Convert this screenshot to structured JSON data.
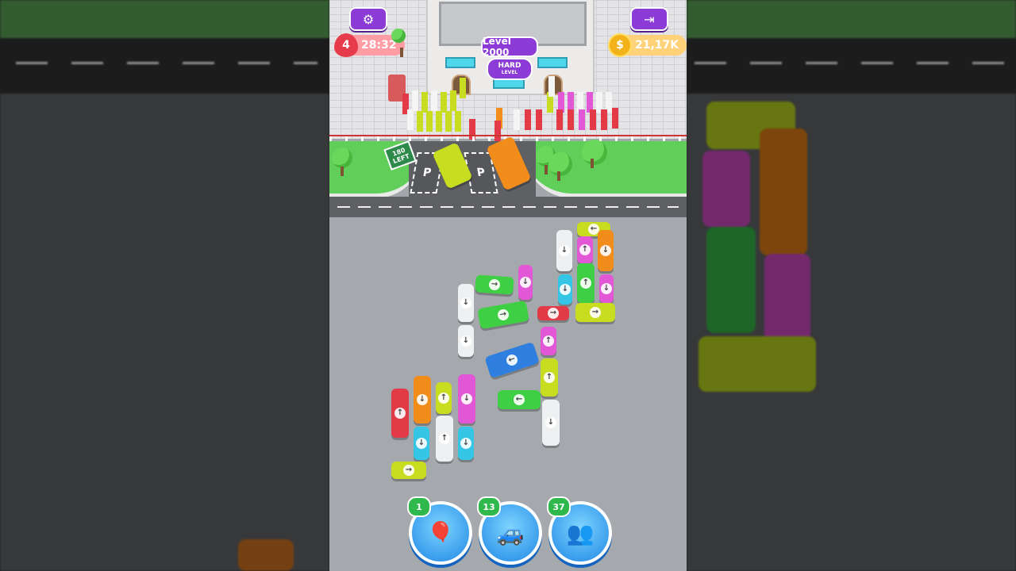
{
  "hud": {
    "settings_icon": "gear-icon",
    "exit_icon": "exit-door-icon",
    "lives": "4",
    "timer": "28:32",
    "coins": "21,17K",
    "coin_symbol": "$"
  },
  "level": {
    "title": "Level 2000",
    "difficulty": "HARD",
    "difficulty_sub": "LEVEL"
  },
  "parking": {
    "sign_count": "180",
    "sign_label": "LEFT",
    "spot_label": "P"
  },
  "arrows": {
    "up": "↑",
    "down": "↓",
    "left": "←",
    "right": "→"
  },
  "boosters": [
    {
      "name": "balloon-booster",
      "icon": "balloon-icon",
      "count": "1",
      "glyph": "🎈"
    },
    {
      "name": "vip-car-booster",
      "icon": "vip-car-icon",
      "count": "13",
      "glyph": "🚙"
    },
    {
      "name": "shuffle-booster",
      "icon": "shuffle-people-icon",
      "count": "37",
      "glyph": "👥"
    }
  ],
  "colors": {
    "accent_purple": "#8d3bd6",
    "red": "#e23b47",
    "orange": "#f28c1b",
    "lime": "#c8dd1f",
    "pink": "#e257d6",
    "cyan": "#35c6e6",
    "white": "#eef0f2",
    "green": "#3fcf44",
    "blue": "#2f7fe0"
  }
}
